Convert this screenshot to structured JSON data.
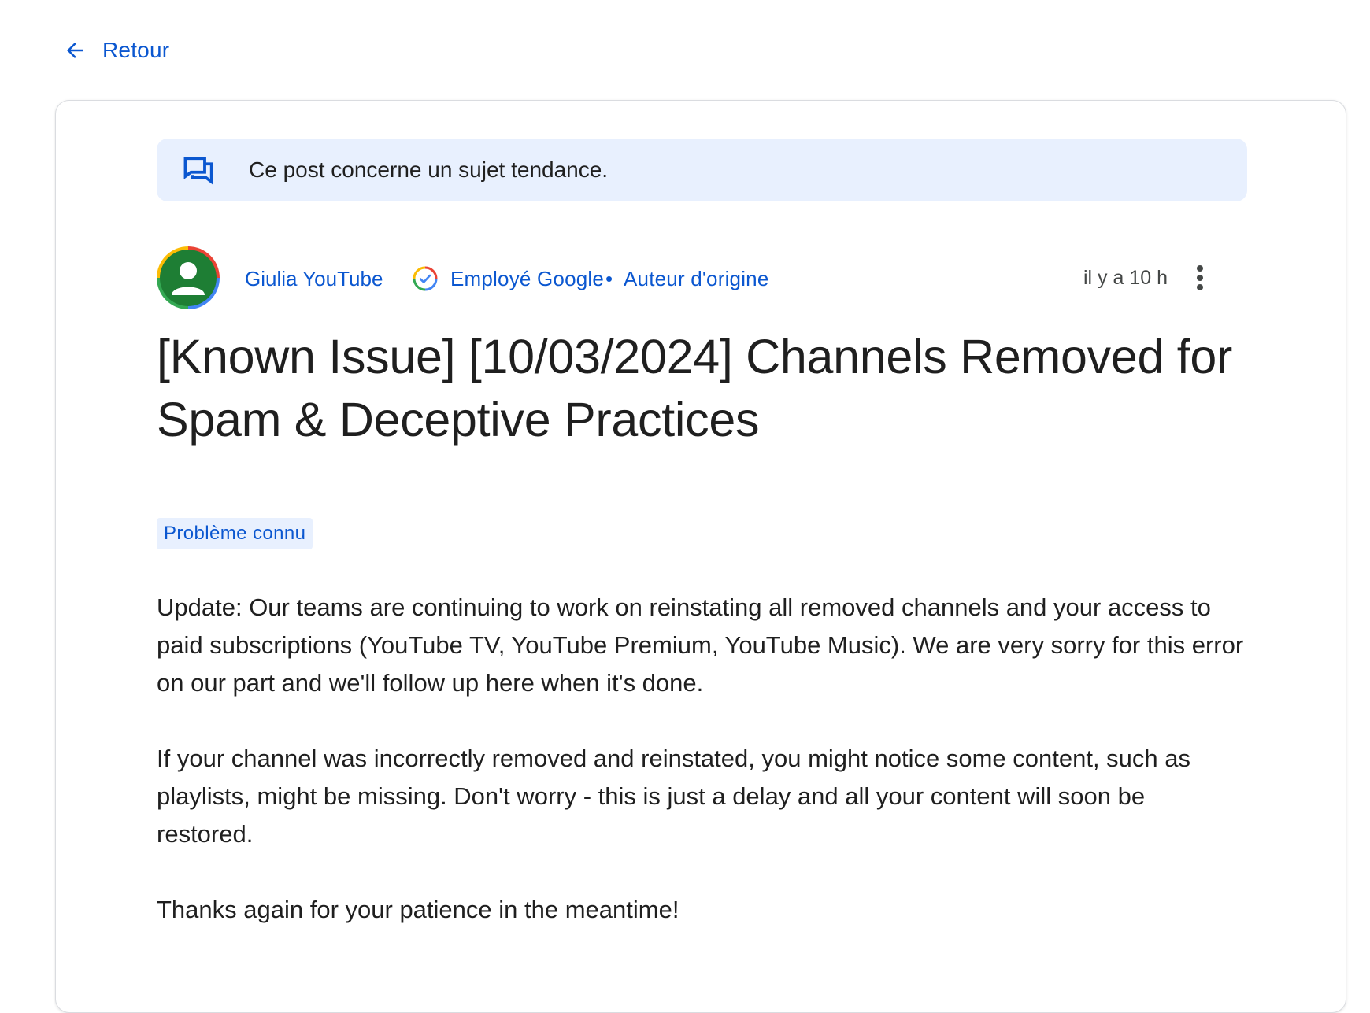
{
  "nav": {
    "back_label": "Retour"
  },
  "banner": {
    "text": "Ce post concerne un sujet tendance."
  },
  "author": {
    "name": "Giulia YouTube",
    "badge": "Employé Google",
    "separator": "•",
    "role": "Auteur d'origine",
    "time": "il y a 10 h"
  },
  "post": {
    "title": "[Known Issue] [10/03/2024] Channels Removed for Spam & Deceptive Practices",
    "tag": "Problème connu",
    "paragraphs": [
      "Update: Our teams are continuing to work on reinstating all removed channels and your access to paid subscriptions (YouTube TV, YouTube Premium, YouTube Music). We are very sorry for this error on our part and we'll follow up here when it's done.",
      "If your channel was incorrectly removed and reinstated, you might notice some content, such as playlists, might be missing. Don't worry - this is just a delay and all your content will soon be restored.",
      "Thanks again for your patience in the meantime!"
    ]
  },
  "icons": {
    "back": "arrow-back-icon",
    "banner": "forum-icon",
    "badge": "google-employee-badge-icon",
    "more": "more-vert-icon",
    "avatar": "person-icon"
  },
  "colors": {
    "link": "#0b57d0",
    "banner_bg": "#e8f0fe",
    "avatar_bg": "#1e7e34",
    "text": "#1f1f1f"
  }
}
